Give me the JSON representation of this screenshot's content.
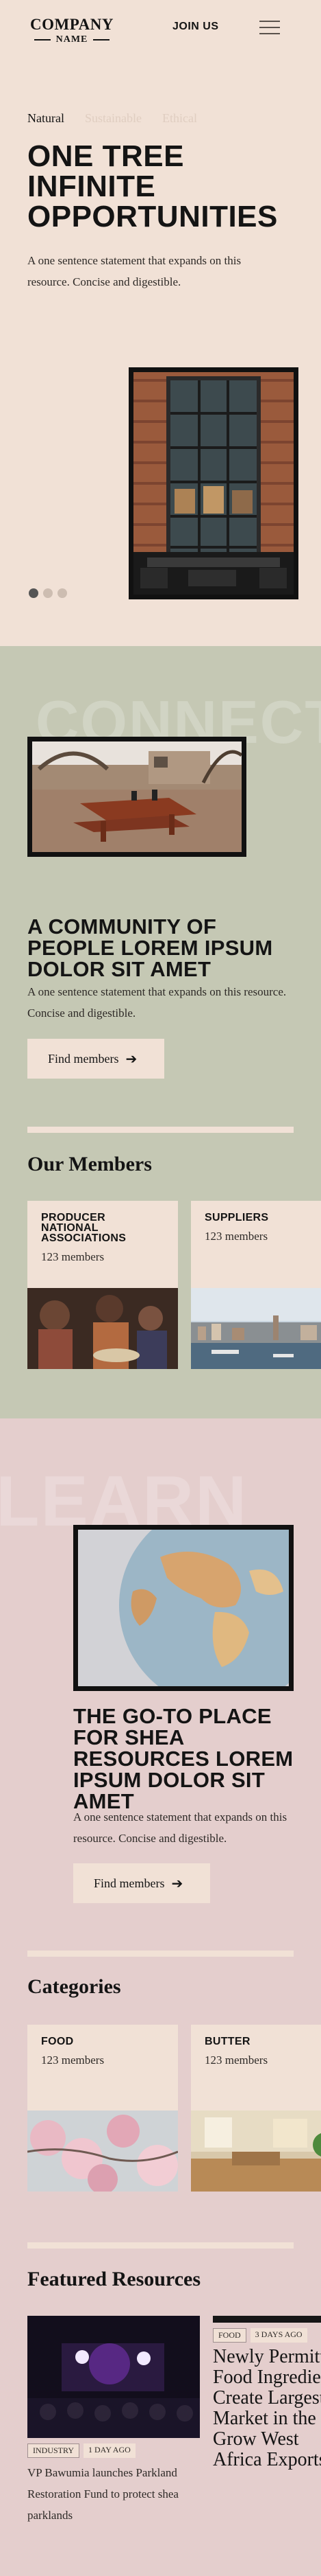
{
  "header": {
    "logo_top": "COMPANY",
    "logo_bottom": "NAME",
    "join": "JOIN US",
    "menu_icon": "hamburger-menu-icon"
  },
  "hero": {
    "tabs": [
      {
        "label": "Natural"
      },
      {
        "label": "Sustainable"
      },
      {
        "label": "Ethical"
      }
    ],
    "title": "ONE TREE INFINITE OPPORTUNITIES",
    "description": "A one sentence statement that expands on this resource. Concise and digestible.",
    "slides_total": 3,
    "slide_active": 1
  },
  "connect": {
    "bg_word": "CONNECT",
    "title": "A COMMUNITY OF PEOPLE LOREM IPSUM DOLOR SIT AMET",
    "description": "A one sentence statement that expands on this resource. Concise and digestible.",
    "button": "Find members",
    "members_heading": "Our Members",
    "members": [
      {
        "label": "PRODUCER NATIONAL ASSOCIATIONS",
        "count": "123 members"
      },
      {
        "label": "SUPPLIERS",
        "count": "123 members"
      }
    ]
  },
  "learn": {
    "bg_word": "LEARN",
    "title": "THE GO-TO PLACE FOR SHEA RESOURCES LOREM IPSUM DOLOR SIT AMET",
    "description": "A one sentence statement that expands on this resource. Concise and digestible.",
    "button": "Find members",
    "categories_heading": "Categories",
    "categories": [
      {
        "label": "FOOD",
        "count": "123 members"
      },
      {
        "label": "BUTTER",
        "count": "123 members"
      }
    ],
    "featured_heading": "Featured Resources",
    "featured": [
      {
        "tag": "INDUSTRY",
        "time": "1 DAY AGO",
        "title": "VP Bawumia launches Parkland Restoration Fund to protect shea parklands"
      },
      {
        "tag": "FOOD",
        "time": "3 DAYS AGO",
        "title": "Newly Permitted Food Ingredients Create Largest Market in the Grow West Africa Exports"
      }
    ]
  },
  "colors": {
    "page_bg": "#f1e1d6",
    "connect_bg": "#c5c8b4",
    "learn_bg": "#e4cecd",
    "text": "#141414"
  }
}
